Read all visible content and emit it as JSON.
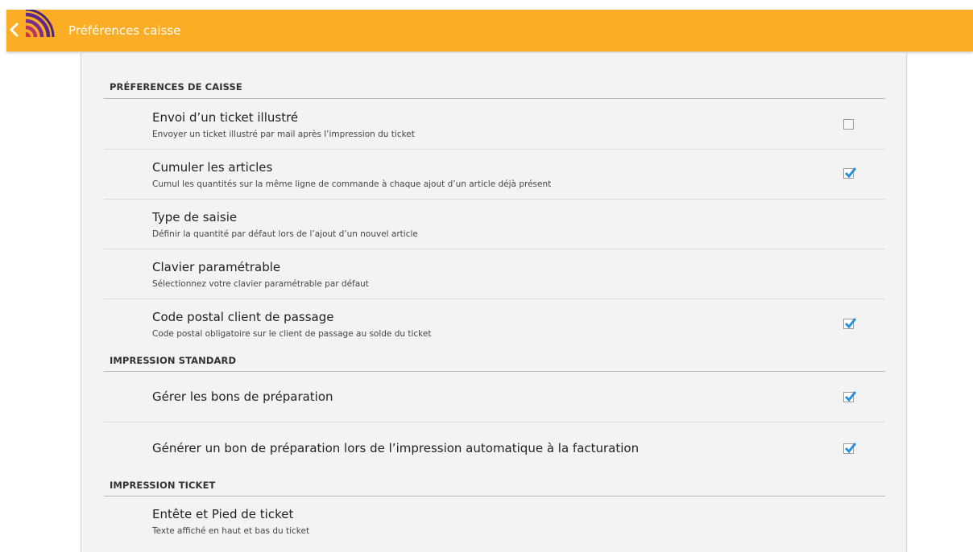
{
  "header": {
    "title": "Préférences caisse",
    "back_icon": "chevron-left-icon",
    "logo_icon": "app-logo-signal",
    "colors": {
      "bar": "#fbad25",
      "logo_purple": "#5c2a8c",
      "logo_red": "#cf3a3a",
      "check": "#2b8fd6"
    }
  },
  "sections": [
    {
      "label": "PRÉFERENCES DE CAISSE"
    },
    {
      "label": "IMPRESSION STANDARD"
    },
    {
      "label": "IMPRESSION TICKET"
    }
  ],
  "prefs": [
    {
      "title": "Envoi d’un ticket illustré",
      "subtitle": "Envoyer un ticket illustré par mail après l’impression du ticket",
      "checked": false
    },
    {
      "title": "Cumuler les articles",
      "subtitle": "Cumul les quantités sur la même ligne de commande à chaque ajout d’un article déjà présent",
      "checked": true
    },
    {
      "title": "Type de saisie",
      "subtitle": "Définir la quantité par défaut lors de l’ajout d’un nouvel article"
    },
    {
      "title": "Clavier paramétrable",
      "subtitle": "Sélectionnez votre clavier paramétrable par défaut"
    },
    {
      "title": "Code postal client de passage",
      "subtitle": "Code postal obligatoire sur le client de passage au solde du ticket",
      "checked": true
    },
    {
      "title": "Gérer les bons de préparation",
      "checked": true
    },
    {
      "title": "Générer un bon de préparation lors de l’impression automatique à la facturation",
      "checked": true
    },
    {
      "title": "Entête et Pied de ticket",
      "subtitle": "Texte affiché en haut et bas du ticket"
    }
  ]
}
